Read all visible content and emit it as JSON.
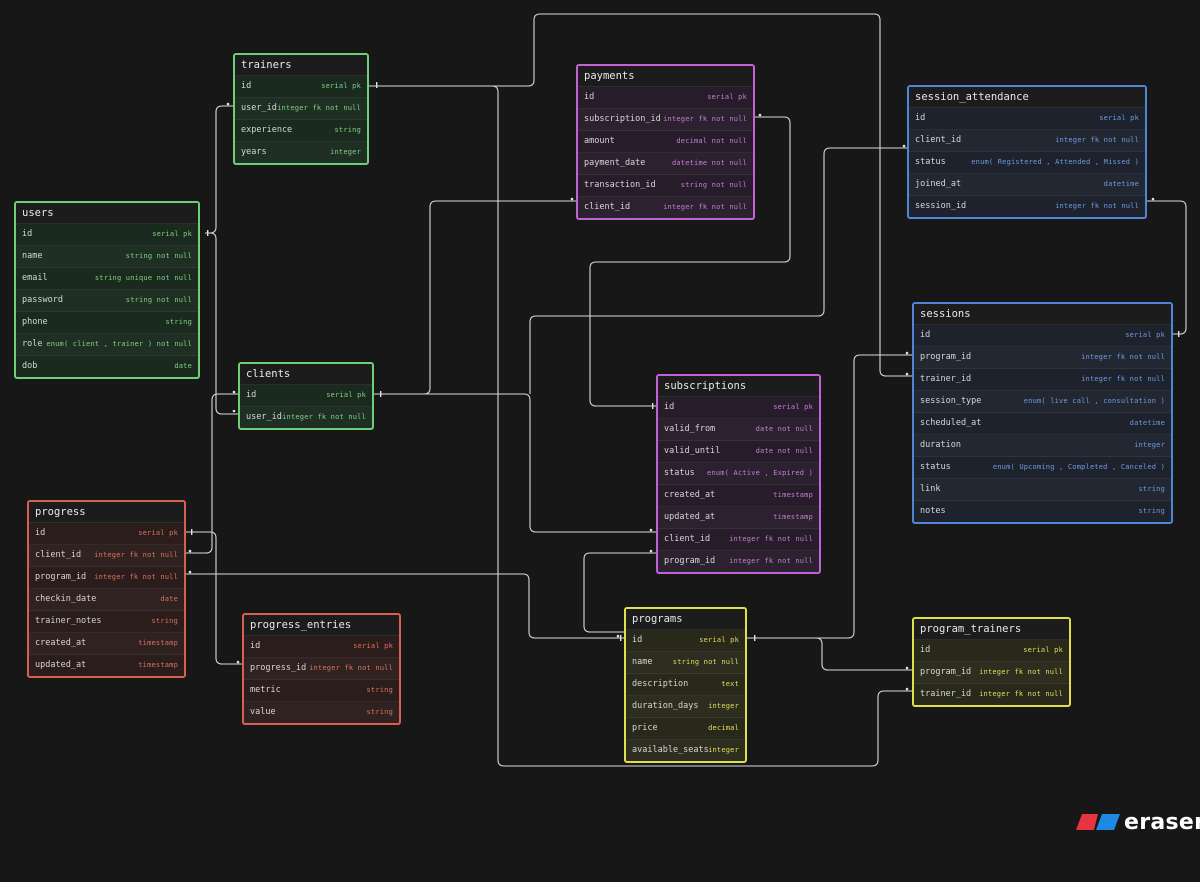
{
  "brand": {
    "name": "eraser",
    "icon": "eraser-logo-icon",
    "colors": [
      "#e8343f",
      "#1e88e5"
    ]
  },
  "entities": {
    "trainers": {
      "title": "trainers",
      "fields": [
        {
          "name": "id",
          "type": "serial pk"
        },
        {
          "name": "user_id",
          "type": "integer fk not null"
        },
        {
          "name": "experience",
          "type": "string"
        },
        {
          "name": "years",
          "type": "integer"
        }
      ]
    },
    "users": {
      "title": "users",
      "fields": [
        {
          "name": "id",
          "type": "serial pk"
        },
        {
          "name": "name",
          "type": "string not null"
        },
        {
          "name": "email",
          "type": "string unique not null"
        },
        {
          "name": "password",
          "type": "string not null"
        },
        {
          "name": "phone",
          "type": "string"
        },
        {
          "name": "role",
          "type": "enum( client , trainer ) not null"
        },
        {
          "name": "dob",
          "type": "date"
        }
      ]
    },
    "clients": {
      "title": "clients",
      "fields": [
        {
          "name": "id",
          "type": "serial pk"
        },
        {
          "name": "user_id",
          "type": "integer fk not null"
        }
      ]
    },
    "progress": {
      "title": "progress",
      "fields": [
        {
          "name": "id",
          "type": "serial pk"
        },
        {
          "name": "client_id",
          "type": "integer fk not null"
        },
        {
          "name": "program_id",
          "type": "integer fk not null"
        },
        {
          "name": "checkin_date",
          "type": "date"
        },
        {
          "name": "trainer_notes",
          "type": "string"
        },
        {
          "name": "created_at",
          "type": "timestamp"
        },
        {
          "name": "updated_at",
          "type": "timestamp"
        }
      ]
    },
    "progress_entries": {
      "title": "progress_entries",
      "fields": [
        {
          "name": "id",
          "type": "serial pk"
        },
        {
          "name": "progress_id",
          "type": "integer fk not null"
        },
        {
          "name": "metric",
          "type": "string"
        },
        {
          "name": "value",
          "type": "string"
        }
      ]
    },
    "payments": {
      "title": "payments",
      "fields": [
        {
          "name": "id",
          "type": "serial pk"
        },
        {
          "name": "subscription_id",
          "type": "integer fk not null"
        },
        {
          "name": "amount",
          "type": "decimal not null"
        },
        {
          "name": "payment_date",
          "type": "datetime not null"
        },
        {
          "name": "transaction_id",
          "type": "string not null"
        },
        {
          "name": "client_id",
          "type": "integer fk not null"
        }
      ]
    },
    "subscriptions": {
      "title": "subscriptions",
      "fields": [
        {
          "name": "id",
          "type": "serial pk"
        },
        {
          "name": "valid_from",
          "type": "date not null"
        },
        {
          "name": "valid_until",
          "type": "date not null"
        },
        {
          "name": "status",
          "type": "enum( Active , Expired )"
        },
        {
          "name": "created_at",
          "type": "timestamp"
        },
        {
          "name": "updated_at",
          "type": "timestamp"
        },
        {
          "name": "client_id",
          "type": "integer fk not null"
        },
        {
          "name": "program_id",
          "type": "integer fk not null"
        }
      ]
    },
    "programs": {
      "title": "programs",
      "fields": [
        {
          "name": "id",
          "type": "serial pk"
        },
        {
          "name": "name",
          "type": "string not null"
        },
        {
          "name": "description",
          "type": "text"
        },
        {
          "name": "duration_days",
          "type": "integer"
        },
        {
          "name": "price",
          "type": "decimal"
        },
        {
          "name": "available_seats",
          "type": "integer"
        }
      ]
    },
    "session_attendance": {
      "title": "session_attendance",
      "fields": [
        {
          "name": "id",
          "type": "serial pk"
        },
        {
          "name": "client_id",
          "type": "integer fk not null"
        },
        {
          "name": "status",
          "type": "enum( Registered , Attended , Missed )"
        },
        {
          "name": "joined_at",
          "type": "datetime"
        },
        {
          "name": "session_id",
          "type": "integer fk not null"
        }
      ]
    },
    "sessions": {
      "title": "sessions",
      "fields": [
        {
          "name": "id",
          "type": "serial pk"
        },
        {
          "name": "program_id",
          "type": "integer fk not null"
        },
        {
          "name": "trainer_id",
          "type": "integer fk not null"
        },
        {
          "name": "session_type",
          "type": "enum( live call , consultation )"
        },
        {
          "name": "scheduled_at",
          "type": "datetime"
        },
        {
          "name": "duration",
          "type": "integer"
        },
        {
          "name": "status",
          "type": "enum( Upcoming , Completed , Canceled )"
        },
        {
          "name": "link",
          "type": "string"
        },
        {
          "name": "notes",
          "type": "string"
        }
      ]
    },
    "program_trainers": {
      "title": "program_trainers",
      "fields": [
        {
          "name": "id",
          "type": "serial pk"
        },
        {
          "name": "program_id",
          "type": "integer fk not null"
        },
        {
          "name": "trainer_id",
          "type": "integer fk not null"
        }
      ]
    }
  },
  "relationships": [
    {
      "from": "trainers.user_id",
      "to": "users.id"
    },
    {
      "from": "clients.user_id",
      "to": "users.id"
    },
    {
      "from": "payments.client_id",
      "to": "clients.id"
    },
    {
      "from": "subscriptions.client_id",
      "to": "clients.id"
    },
    {
      "from": "progress.client_id",
      "to": "clients.id"
    },
    {
      "from": "progress_entries.progress_id",
      "to": "progress.id"
    },
    {
      "from": "progress.program_id",
      "to": "programs.id"
    },
    {
      "from": "payments.subscription_id",
      "to": "subscriptions.id"
    },
    {
      "from": "subscriptions.program_id",
      "to": "programs.id"
    },
    {
      "from": "sessions.program_id",
      "to": "programs.id"
    },
    {
      "from": "sessions.trainer_id",
      "to": "trainers.id"
    },
    {
      "from": "program_trainers.program_id",
      "to": "programs.id"
    },
    {
      "from": "program_trainers.trainer_id",
      "to": "trainers.id"
    },
    {
      "from": "session_attendance.session_id",
      "to": "sessions.id"
    },
    {
      "from": "session_attendance.client_id",
      "to": "clients.id"
    }
  ]
}
